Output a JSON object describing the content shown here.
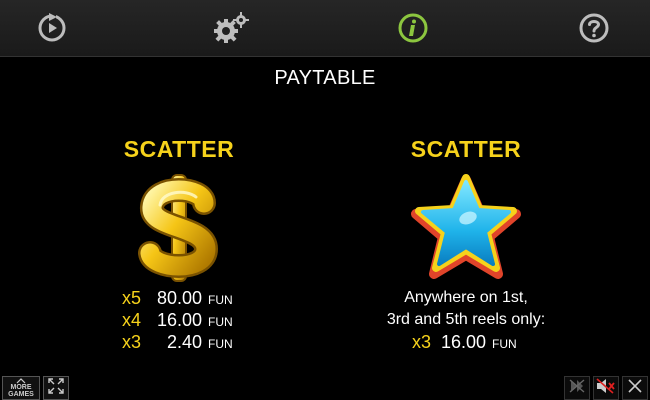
{
  "topbar": {
    "buttons": [
      {
        "icon": "replay-icon"
      },
      {
        "icon": "settings-gears-icon"
      },
      {
        "icon": "info-icon",
        "active": true,
        "active_color": "#8cc63f"
      },
      {
        "icon": "help-icon"
      }
    ]
  },
  "title": "PAYTABLE",
  "symbols": [
    {
      "name": "SCATTER",
      "icon": "dollar-sign-icon",
      "payouts": [
        {
          "mult": "x5",
          "amount": "80.00",
          "unit": "FUN"
        },
        {
          "mult": "x4",
          "amount": "16.00",
          "unit": "FUN"
        },
        {
          "mult": "x3",
          "amount": "2.40",
          "unit": "FUN"
        }
      ]
    },
    {
      "name": "SCATTER",
      "icon": "star-icon",
      "description_lines": [
        "Anywhere on 1st,",
        "3rd and 5th reels only:"
      ],
      "payouts": [
        {
          "mult": "x3",
          "amount": "16.00",
          "unit": "FUN"
        }
      ]
    }
  ],
  "bottom_left": {
    "more_games_label_line1": "MORE",
    "more_games_label_line2": "GAMES"
  },
  "colors": {
    "accent_yellow": "#f6d21b",
    "info_green": "#8cc63f",
    "background": "#000000",
    "topbar": "#1f1f1f"
  }
}
